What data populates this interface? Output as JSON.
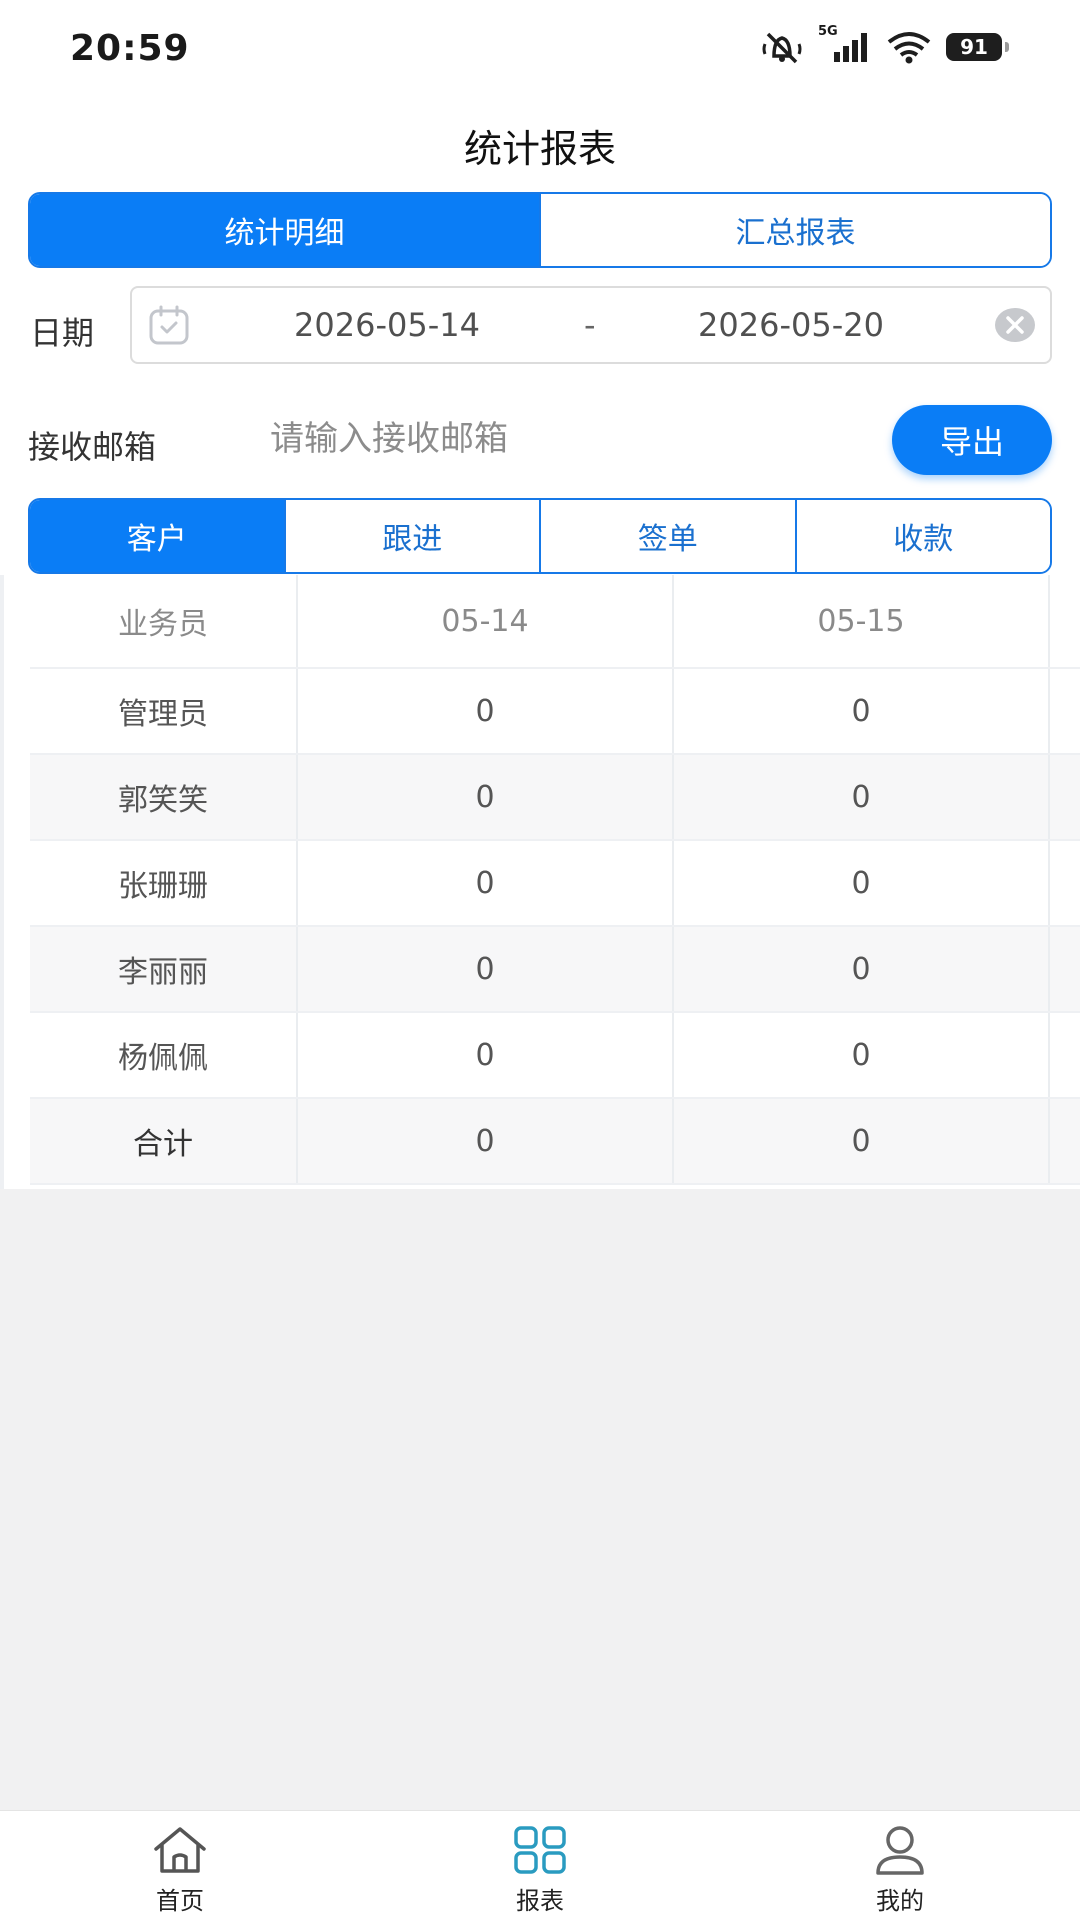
{
  "status_bar": {
    "time": "20:59",
    "network": "5G",
    "battery": "91"
  },
  "page": {
    "title": "统计报表"
  },
  "view_tabs": [
    {
      "label": "统计明细",
      "active": true
    },
    {
      "label": "汇总报表",
      "active": false
    }
  ],
  "date_filter": {
    "label": "日期",
    "start": "2026-05-14",
    "separator": "-",
    "end": "2026-05-20"
  },
  "email": {
    "label": "接收邮箱",
    "value": "",
    "placeholder": "请输入接收邮箱",
    "export_label": "导出"
  },
  "category_tabs": [
    {
      "label": "客户",
      "active": true
    },
    {
      "label": "跟进",
      "active": false
    },
    {
      "label": "签单",
      "active": false
    },
    {
      "label": "收款",
      "active": false
    }
  ],
  "table": {
    "headers": [
      "业务员",
      "05-14",
      "05-15"
    ],
    "rows": [
      [
        "管理员",
        "0",
        "0"
      ],
      [
        "郭笑笑",
        "0",
        "0"
      ],
      [
        "张珊珊",
        "0",
        "0"
      ],
      [
        "李丽丽",
        "0",
        "0"
      ],
      [
        "杨佩佩",
        "0",
        "0"
      ],
      [
        "合计",
        "0",
        "0"
      ]
    ]
  },
  "bottom_nav": [
    {
      "label": "首页",
      "icon": "home-icon",
      "active": false
    },
    {
      "label": "报表",
      "icon": "grid-icon",
      "active": true
    },
    {
      "label": "我的",
      "icon": "user-icon",
      "active": false
    }
  ],
  "colors": {
    "accent": "#0a7df6",
    "accent_text": "#1a70cf",
    "nav_active": "#2a9bc0"
  }
}
